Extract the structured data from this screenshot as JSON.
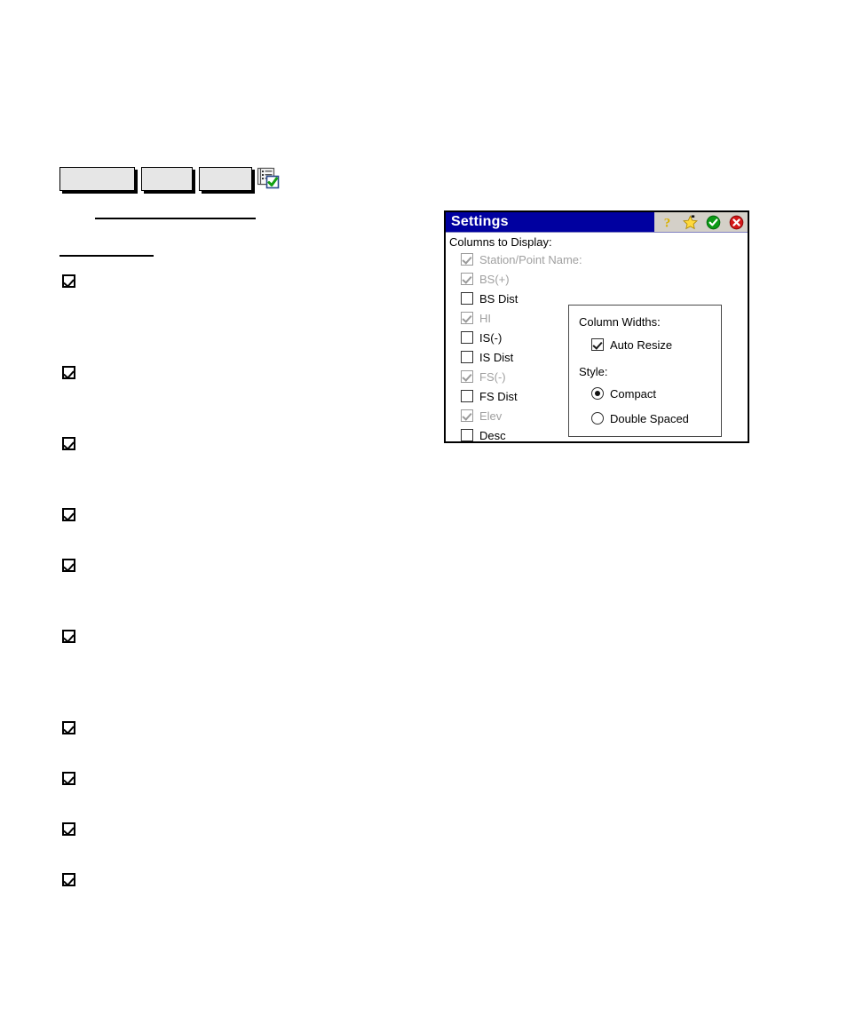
{
  "page": {
    "background": "#ffffff",
    "toolbar_buttons": [
      {
        "label": ""
      },
      {
        "label": ""
      },
      {
        "label": ""
      }
    ],
    "toolbar_icon": "list-check-icon",
    "checkbox_marks": [
      {
        "checked": true
      },
      {
        "checked": true
      },
      {
        "checked": true
      },
      {
        "checked": true
      },
      {
        "checked": true
      },
      {
        "checked": true
      },
      {
        "checked": true
      },
      {
        "checked": true
      },
      {
        "checked": true
      },
      {
        "checked": true
      }
    ]
  },
  "dialog": {
    "title": "Settings",
    "colors": {
      "titlebar": "#0000a0",
      "titlebar_text": "#ffffff",
      "toolbar_strip": "#d4d0c8",
      "body": "#ffffff",
      "border": "#000000",
      "disabled_text": "#a0a0a0",
      "ok_green": "#00a000",
      "cancel_red": "#cc0000",
      "star_yellow": "#ffd700"
    },
    "titlebar_icons": [
      {
        "name": "help-icon",
        "glyph": "?"
      },
      {
        "name": "favorites-star-icon",
        "glyph": "star"
      },
      {
        "name": "ok-check-icon",
        "glyph": "check"
      },
      {
        "name": "close-x-icon",
        "glyph": "x"
      }
    ],
    "columns_section": {
      "label": "Columns to Display:",
      "items": [
        {
          "label": "Station/Point Name:",
          "checked": true,
          "enabled": false
        },
        {
          "label": "BS(+)",
          "checked": true,
          "enabled": false
        },
        {
          "label": "BS Dist",
          "checked": false,
          "enabled": true
        },
        {
          "label": "HI",
          "checked": true,
          "enabled": false
        },
        {
          "label": "IS(-)",
          "checked": false,
          "enabled": true
        },
        {
          "label": "IS Dist",
          "checked": false,
          "enabled": true
        },
        {
          "label": "FS(-)",
          "checked": true,
          "enabled": false
        },
        {
          "label": "FS Dist",
          "checked": false,
          "enabled": true
        },
        {
          "label": "Elev",
          "checked": true,
          "enabled": false
        },
        {
          "label": "Desc",
          "checked": false,
          "enabled": true
        }
      ]
    },
    "widths_panel": {
      "column_widths_label": "Column Widths:",
      "auto_resize": {
        "label": "Auto Resize",
        "checked": true
      },
      "style_label": "Style:",
      "style_options": [
        {
          "label": "Compact",
          "selected": true
        },
        {
          "label": "Double Spaced",
          "selected": false
        }
      ]
    }
  }
}
